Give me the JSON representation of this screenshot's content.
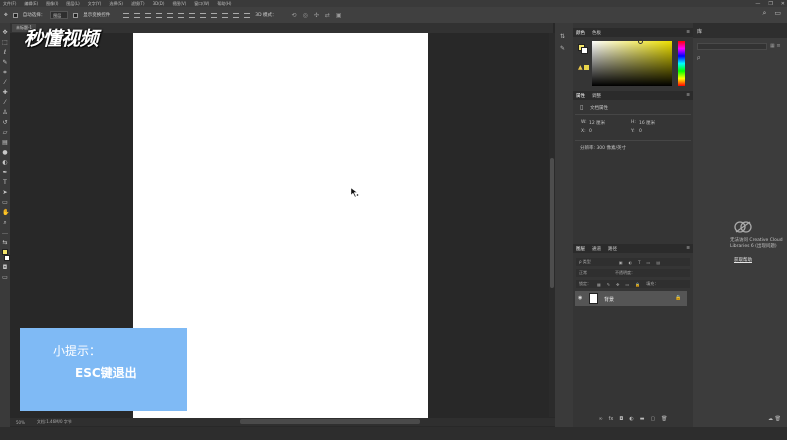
{
  "menubar": {
    "items": [
      "文件(F)",
      "编辑(E)",
      "图像(I)",
      "图层(L)",
      "文字(Y)",
      "选择(S)",
      "滤镜(T)",
      "3D(D)",
      "视图(V)",
      "窗口(W)",
      "帮助(H)"
    ],
    "window_controls": [
      "—",
      "❐",
      "✕"
    ]
  },
  "optionsbar": {
    "auto_select_label": "自动选择：",
    "auto_select_value": "图层",
    "transform_label": "显示变换控件",
    "mode_label": "3D 模式："
  },
  "document": {
    "tab_label": "未标题-1",
    "zoom": "50%",
    "doc_info": "文档:1.46M/0 字节"
  },
  "overlay": {
    "logo_text": "秒懂视频",
    "tip_title": "小提示：",
    "tip_text": "ESC键退出",
    "tip_color": "#7fbaf5"
  },
  "color_panel": {
    "tabs": [
      "颜色",
      "色板"
    ],
    "foreground": "#f4e56b",
    "background": "#ffffff"
  },
  "properties_panel": {
    "tabs": [
      "属性",
      "调整"
    ],
    "heading": "文档属性",
    "width_label": "W:",
    "width_value": "12 厘米",
    "height_label": "H:",
    "height_value": "16 厘米",
    "x_label": "X:",
    "x_value": "0",
    "y_label": "Y:",
    "y_value": "0",
    "resolution": "分辨率: 300 像素/英寸"
  },
  "layers_panel": {
    "tabs": [
      "图层",
      "通道",
      "路径"
    ],
    "filter_label": "ρ 类型",
    "blend_mode": "正常",
    "opacity_label": "不透明度：",
    "lock_label": "锁定：",
    "fill_label": "填充：",
    "layer_name": "背景",
    "footer_icons": [
      "link-icon",
      "fx-icon",
      "mask-icon",
      "adjustment-icon",
      "folder-icon",
      "new-layer-icon",
      "trash-icon"
    ]
  },
  "libraries_panel": {
    "tab": "库",
    "search_icon": "ρ",
    "message": "无法访问 Creative Cloud Libraries 6 (出现问题)",
    "link": "获取帮助"
  }
}
